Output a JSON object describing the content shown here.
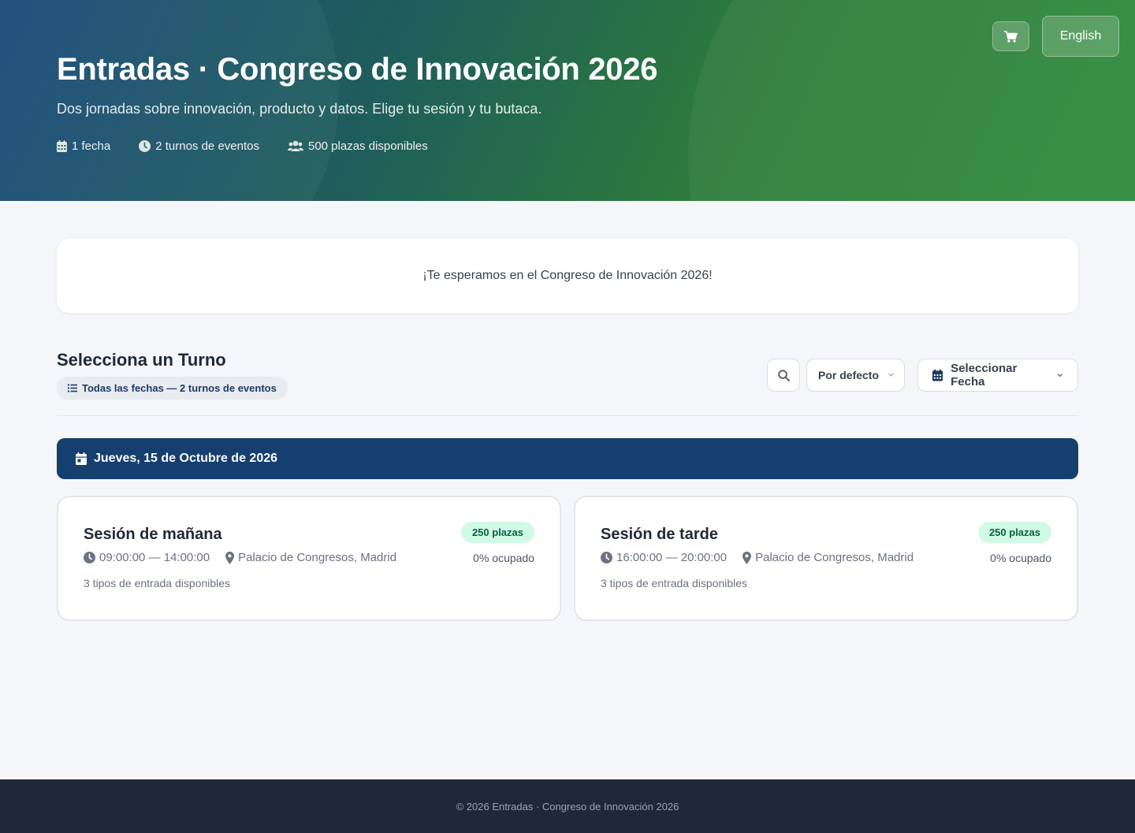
{
  "hero": {
    "title": "Entradas · Congreso de Innovación 2026",
    "subtitle": "Dos jornadas sobre innovación, producto y datos. Elige tu sesión y tu butaca.",
    "stats": [
      {
        "icon": "calendar-icon",
        "text": "1 fecha"
      },
      {
        "icon": "clock-icon",
        "text": "2 turnos de eventos"
      },
      {
        "icon": "users-icon",
        "text": "500 plazas disponibles"
      }
    ],
    "cart_icon": "cart-icon",
    "language_label": "English"
  },
  "welcome": {
    "message": "¡Te esperamos en el Congreso de Innovación 2026!"
  },
  "shifts": {
    "title": "Selecciona un Turno",
    "filter_pill": "Todas las fechas — 2 turnos de eventos",
    "sort_selected": "Por defecto",
    "date_select_label": "Seleccionar Fecha"
  },
  "date_group": {
    "label": "Jueves, 15 de Octubre de 2026",
    "sessions": [
      {
        "name": "Sesión de mañana",
        "time": "09:00:00 — 14:00:00",
        "location": "Palacio de Congresos, Madrid",
        "ticket_types": "3 tipos de entrada disponibles",
        "capacity_badge": "250 plazas",
        "occupancy": "0% ocupado"
      },
      {
        "name": "Sesión de tarde",
        "time": "16:00:00 — 20:00:00",
        "location": "Palacio de Congresos, Madrid",
        "ticket_types": "3 tipos de entrada disponibles",
        "capacity_badge": "250 plazas",
        "occupancy": "0% ocupado"
      }
    ]
  },
  "footer": {
    "text": "© 2026 Entradas · Congreso de Innovación 2026"
  },
  "colors": {
    "hero_gradient_start": "#1a4a7a",
    "hero_gradient_end": "#2f8a3b",
    "date_bar": "#153f6f",
    "badge_bg": "#d1fae5",
    "badge_text": "#065f46",
    "footer_bg": "#1f2738"
  }
}
